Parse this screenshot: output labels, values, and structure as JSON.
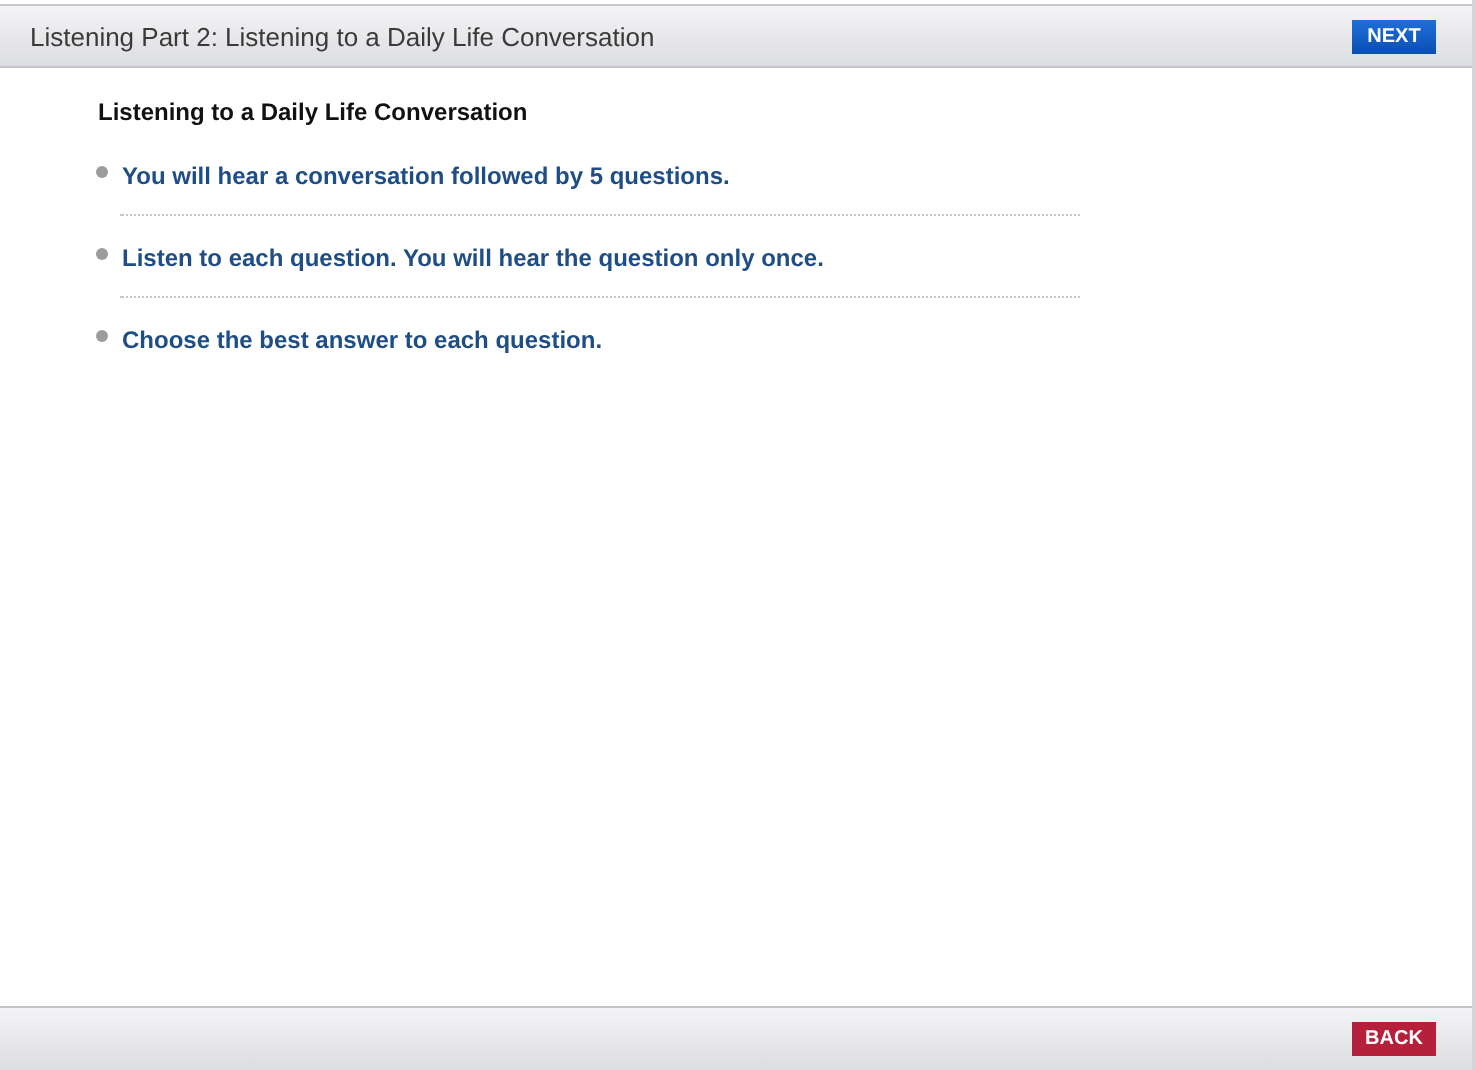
{
  "header": {
    "title": "Listening Part 2: Listening to a Daily Life Conversation",
    "next_button": "NEXT"
  },
  "content": {
    "heading": "Listening to a Daily Life Conversation",
    "instructions": [
      {
        "text": "You will hear a conversation followed by 5 questions."
      },
      {
        "text": "Listen to each question. You will hear the question only once."
      },
      {
        "text": "Choose the best answer to each question."
      }
    ]
  },
  "footer": {
    "back_button": "BACK"
  }
}
